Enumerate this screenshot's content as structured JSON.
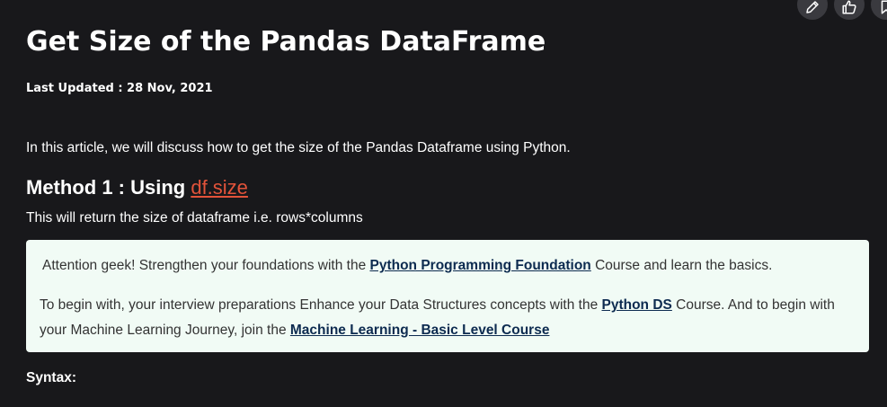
{
  "toolbar": {
    "buttons": [
      {
        "icon": "pencil-icon"
      },
      {
        "icon": "thumbs-up-icon"
      },
      {
        "icon": "bookmark-icon"
      }
    ]
  },
  "article": {
    "title": "Get Size of the Pandas DataFrame",
    "last_updated": "Last Updated : 28 Nov, 2021",
    "intro": "In this article, we will discuss how to get the size of the Pandas Dataframe using Python.",
    "method_heading_prefix": "Method 1 : Using ",
    "method_heading_link": "df.size",
    "method_description": "This will return the size of dataframe  i.e. rows*columns",
    "syntax_label": "Syntax:"
  },
  "promo": {
    "line1_prefix": "Attention geek! Strengthen your foundations with the ",
    "line1_link": "Python Programming Foundation",
    "line1_suffix": " Course and learn the basics.",
    "line2_prefix": "To begin with, your interview preparations Enhance your Data Structures concepts with the ",
    "line2_link1": "Python DS",
    "line2_middle": " Course. And to begin with your Machine Learning Journey, join the ",
    "line2_link2": "Machine Learning - Basic Level Course"
  },
  "colors": {
    "background": "#18181b",
    "link_accent": "#e2533a",
    "promo_background": "#f1fbf5",
    "promo_link": "#0d2b50"
  }
}
